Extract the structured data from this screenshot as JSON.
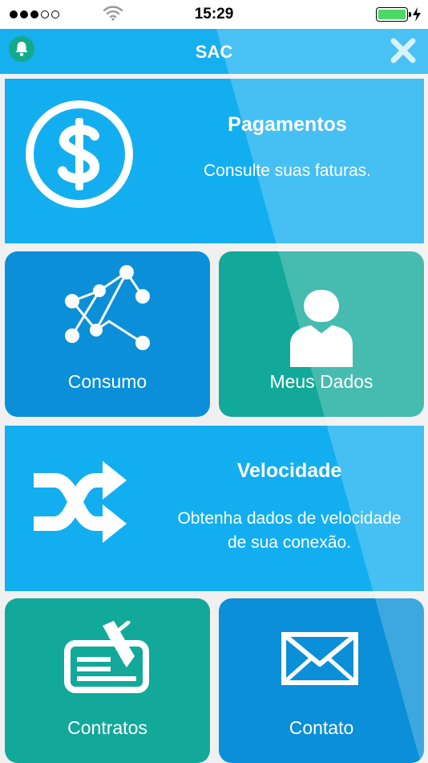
{
  "status_bar": {
    "time": "15:29",
    "signal_bars_filled": 3,
    "signal_bars_total": 5,
    "battery_level": 1.0
  },
  "nav": {
    "title": "SAC",
    "left_icon": "bell-icon",
    "right_icon": "close-icon"
  },
  "menu": {
    "pagamentos": {
      "title": "Pagamentos",
      "subtitle": "Consulte suas faturas.",
      "icon": "dollar-circle-icon"
    },
    "consumo": {
      "label": "Consumo",
      "icon": "chart-network-icon"
    },
    "meus_dados": {
      "label": "Meus Dados",
      "icon": "user-icon"
    },
    "velocidade": {
      "title": "Velocidade",
      "subtitle_line1": "Obtenha dados de velocidade",
      "subtitle_line2": "de sua conexão.",
      "icon": "shuffle-arrows-icon"
    },
    "contratos": {
      "label": "Contratos",
      "icon": "contract-pen-icon"
    },
    "contato": {
      "label": "Contato",
      "icon": "envelope-icon"
    }
  },
  "colors": {
    "primary_blue": "#13aef0",
    "dark_blue": "#0a8fd8",
    "teal": "#12a89a",
    "nav_blue": "#16b0ef",
    "battery_green": "#4cd964"
  }
}
